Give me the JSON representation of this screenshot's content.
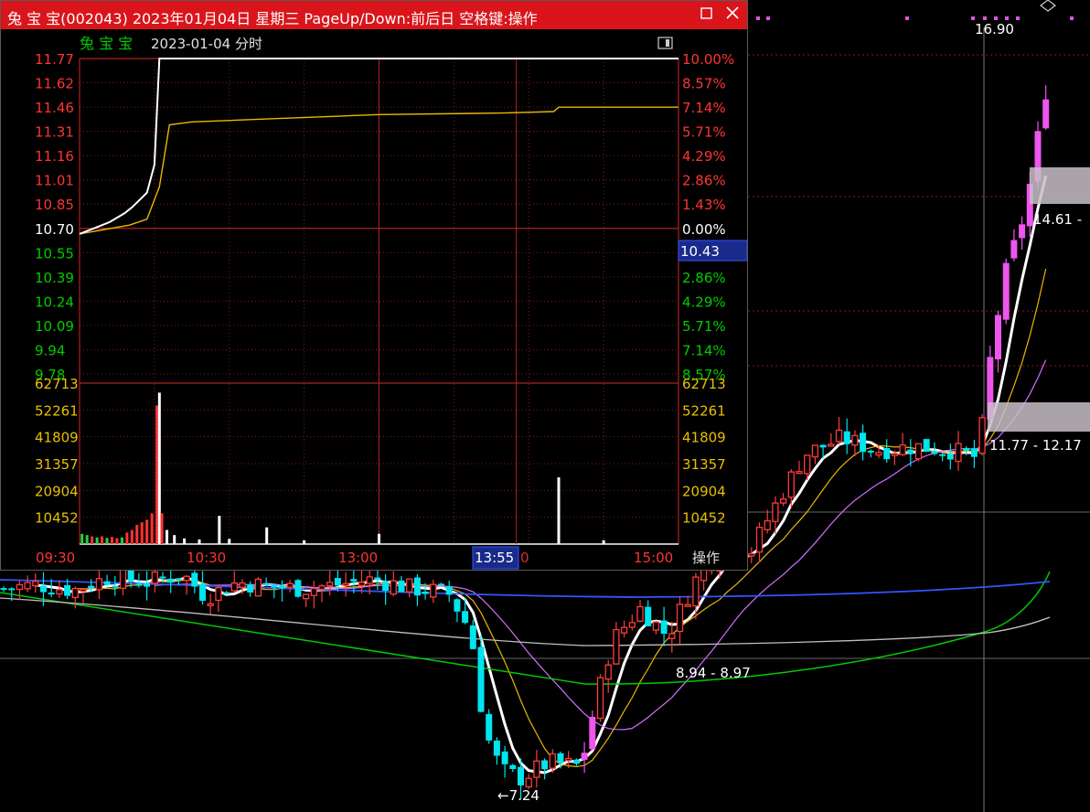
{
  "window": {
    "title": "兔 宝 宝(002043) 2023年01月04日 星期三 PageUp/Down:前后日 空格键:操作",
    "maximize_icon": "square-icon",
    "close_icon": "x-icon"
  },
  "intraday": {
    "stock_name": "兔 宝 宝",
    "date_label": "2023-01-04 分时",
    "prev_close": 10.7,
    "price_labels": [
      "11.77",
      "11.62",
      "11.46",
      "11.31",
      "11.16",
      "11.01",
      "10.85",
      "10.70",
      "10.55",
      "10.39",
      "10.24",
      "10.09",
      "9.94",
      "9.78"
    ],
    "pct_labels": [
      "10.00%",
      "8.57%",
      "7.14%",
      "5.71%",
      "4.29%",
      "2.86%",
      "1.43%",
      "0.00%",
      "1.43%",
      "2.86%",
      "4.29%",
      "5.71%",
      "7.14%",
      "8.57%"
    ],
    "volume_labels": [
      "62713",
      "52261",
      "41809",
      "31357",
      "20904",
      "10452"
    ],
    "time_labels": [
      "09:30",
      "10:30",
      "13:00",
      "15:00"
    ],
    "cursor_time": "13:55",
    "cursor_price": "10.43",
    "cursor_tail": "0",
    "operate_label": "操作",
    "colors": {
      "price_line": "#ffffff",
      "avg_line": "#e8b800",
      "up": "#ff3333",
      "down": "#2ecc40",
      "grid": "#8a1a1a",
      "axis_up": "#ff3333",
      "axis_down": "#00cc00",
      "axis_vol": "#e8c000"
    },
    "chart_data": {
      "type": "line",
      "title": "2023-01-04 分时",
      "xlabel": "",
      "ylabel": "",
      "ylim": [
        9.7,
        11.77
      ],
      "x_ticks": [
        "09:30",
        "10:30",
        "13:00",
        "15:00"
      ],
      "series": [
        {
          "values_time": [
            "09:30",
            "09:33",
            "09:36",
            "09:39",
            "09:42",
            "09:45",
            "09:48",
            "09:51",
            "09:54",
            "09:57",
            "10:00",
            "10:02",
            "10:04",
            "10:06",
            "10:08",
            "10:12",
            "13:00",
            "14:10",
            "14:12",
            "15:00"
          ],
          "values": [
            10.58,
            10.6,
            10.62,
            10.64,
            10.66,
            10.69,
            10.72,
            10.76,
            10.81,
            10.86,
            11.05,
            11.77,
            11.77,
            11.77,
            11.77,
            11.77,
            11.77,
            11.77,
            11.77,
            11.77
          ]
        },
        {
          "values_time": [
            "09:30",
            "09:40",
            "09:50",
            "09:57",
            "10:02",
            "10:06",
            "10:15",
            "10:45",
            "11:15",
            "13:00",
            "13:50",
            "14:10",
            "14:12",
            "14:40",
            "15:00"
          ],
          "values": [
            10.58,
            10.61,
            10.64,
            10.68,
            10.9,
            11.32,
            11.34,
            11.36,
            11.38,
            11.39,
            11.4,
            11.41,
            11.44,
            11.44,
            11.44
          ]
        }
      ],
      "volume": {
        "ylim": [
          0,
          62713
        ],
        "bars": [
          {
            "t": "09:31",
            "v": 4000,
            "c": "g"
          },
          {
            "t": "09:33",
            "v": 3500,
            "c": "g"
          },
          {
            "t": "09:35",
            "v": 3000,
            "c": "r"
          },
          {
            "t": "09:37",
            "v": 2600,
            "c": "g"
          },
          {
            "t": "09:39",
            "v": 3000,
            "c": "r"
          },
          {
            "t": "09:41",
            "v": 2400,
            "c": "g"
          },
          {
            "t": "09:43",
            "v": 2800,
            "c": "r"
          },
          {
            "t": "09:45",
            "v": 2300,
            "c": "r"
          },
          {
            "t": "09:47",
            "v": 2600,
            "c": "g"
          },
          {
            "t": "09:49",
            "v": 4500,
            "c": "r"
          },
          {
            "t": "09:51",
            "v": 5500,
            "c": "r"
          },
          {
            "t": "09:53",
            "v": 7500,
            "c": "r"
          },
          {
            "t": "09:55",
            "v": 8500,
            "c": "r"
          },
          {
            "t": "09:57",
            "v": 9500,
            "c": "r"
          },
          {
            "t": "09:59",
            "v": 12000,
            "c": "r"
          },
          {
            "t": "10:01",
            "v": 54000,
            "c": "r"
          },
          {
            "t": "10:02",
            "v": 59000,
            "c": "w"
          },
          {
            "t": "10:03",
            "v": 12000,
            "c": "r"
          },
          {
            "t": "10:05",
            "v": 5500,
            "c": "w"
          },
          {
            "t": "10:08",
            "v": 3500,
            "c": "w"
          },
          {
            "t": "10:12",
            "v": 2200,
            "c": "w"
          },
          {
            "t": "10:18",
            "v": 1800,
            "c": "w"
          },
          {
            "t": "10:26",
            "v": 11000,
            "c": "w"
          },
          {
            "t": "10:30",
            "v": 2000,
            "c": "w"
          },
          {
            "t": "10:45",
            "v": 6500,
            "c": "w"
          },
          {
            "t": "11:00",
            "v": 1500,
            "c": "w"
          },
          {
            "t": "13:00",
            "v": 4000,
            "c": "w"
          },
          {
            "t": "14:12",
            "v": 26000,
            "c": "w"
          },
          {
            "t": "14:30",
            "v": 1500,
            "c": "w"
          }
        ]
      }
    }
  },
  "kline": {
    "labels": {
      "high_label": "16.90",
      "price_range_1": "14.61 -",
      "price_range_2": "11.77 - 12.17",
      "low_label": "←7.24",
      "mid_range": "8.94 - 8.97"
    },
    "colors": {
      "up": "#ff3b3b",
      "down": "#00e5ee",
      "limit_up": "#ee55ee",
      "ma5": "#ffffff",
      "ma10": "#e8b800",
      "ma20": "#d070ff",
      "ma60": "#00cc00",
      "ma120": "#c0c0c0",
      "ma250": "#3355ff",
      "grid": "#8a1a1a"
    }
  }
}
